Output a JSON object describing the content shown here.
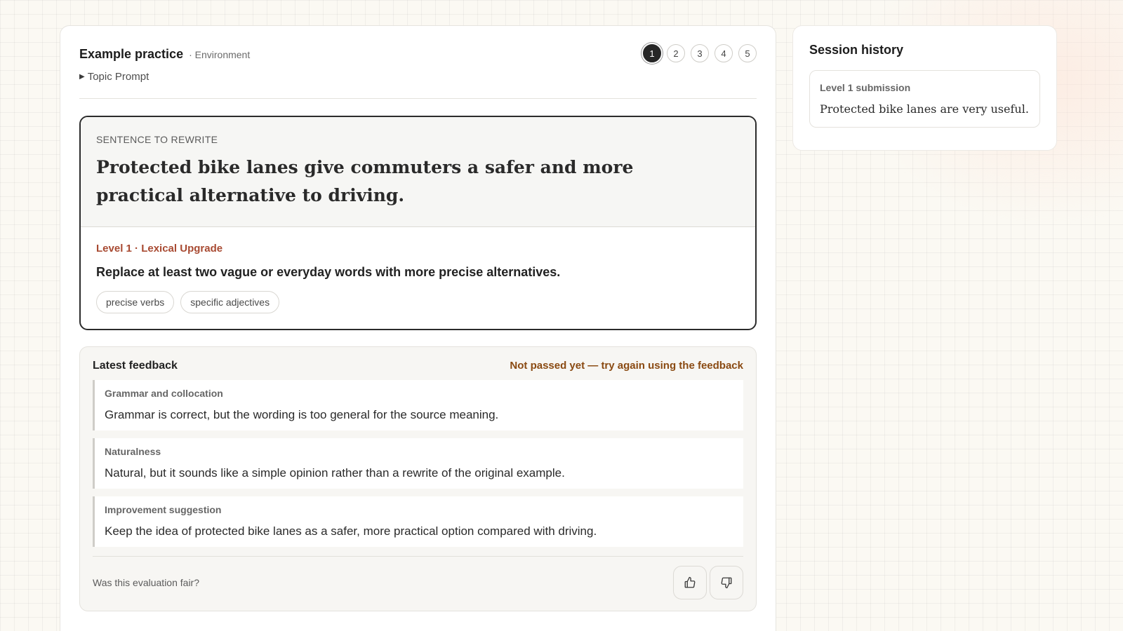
{
  "header": {
    "title": "Example practice",
    "subtitle": "· Environment",
    "topic_toggle": "Topic Prompt",
    "steps": [
      "1",
      "2",
      "3",
      "4",
      "5"
    ],
    "active_step": "1"
  },
  "task": {
    "section_label": "SENTENCE TO REWRITE",
    "sentence": "Protected bike lanes give commuters a safer and more practical alternative to driving.",
    "level_label": "Level 1 · Lexical Upgrade",
    "instruction": "Replace at least two vague or everyday words with more precise alternatives.",
    "tags": [
      "precise verbs",
      "specific adjectives"
    ]
  },
  "feedback": {
    "title": "Latest feedback",
    "status": "Not passed yet — try again using the feedback",
    "items": [
      {
        "label": "Grammar and collocation",
        "text": "Grammar is correct, but the wording is too general for the source meaning."
      },
      {
        "label": "Naturalness",
        "text": "Natural, but it sounds like a simple opinion rather than a rewrite of the original example."
      },
      {
        "label": "Improvement suggestion",
        "text": "Keep the idea of protected bike lanes as a safer, more practical option compared with driving."
      }
    ],
    "fair_question": "Was this evaluation fair?",
    "thumbs_up_icon": "thumbs-up-icon",
    "thumbs_down_icon": "thumbs-down-icon"
  },
  "sidebar": {
    "title": "Session history",
    "items": [
      {
        "label": "Level 1 submission",
        "text": "Protected bike lanes are very useful."
      }
    ]
  },
  "colors": {
    "accent_level": "#a84a32",
    "status_warning": "#8a4a12",
    "active_step": "#262626"
  }
}
